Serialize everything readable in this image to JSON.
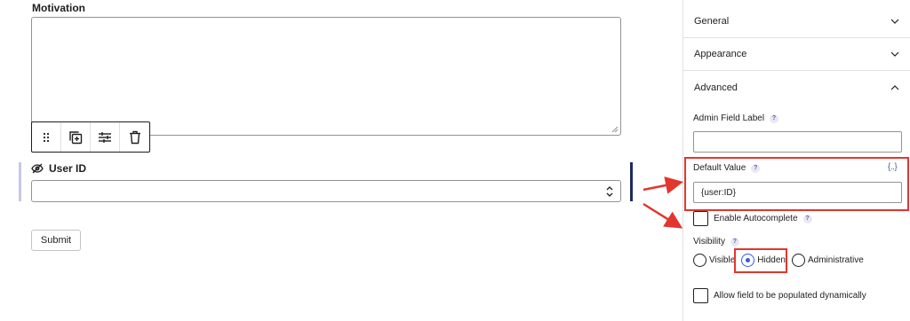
{
  "form": {
    "motivation_label": "Motivation",
    "userid_label": "User ID",
    "submit_label": "Submit",
    "toolbar": [
      "drag-handle",
      "duplicate",
      "settings",
      "delete"
    ]
  },
  "sidebar": {
    "panels": {
      "general": "General",
      "appearance": "Appearance",
      "advanced": "Advanced"
    },
    "admin_label": "Admin Field Label",
    "admin_value": "",
    "default_value_label": "Default Value",
    "merge_tag": "{..}",
    "default_value": "{user:ID}",
    "autocomplete_label": "Enable Autocomplete",
    "visibility_label": "Visibility",
    "visibility_options": [
      "Visible",
      "Hidden",
      "Administrative"
    ],
    "visibility_selected": "Hidden",
    "dynamic_label": "Allow field to be populated dynamically",
    "help_icon": "?"
  },
  "colors": {
    "highlight": "#e2362e",
    "accent": "#3858e9",
    "insertion": "#1d2a5b"
  }
}
